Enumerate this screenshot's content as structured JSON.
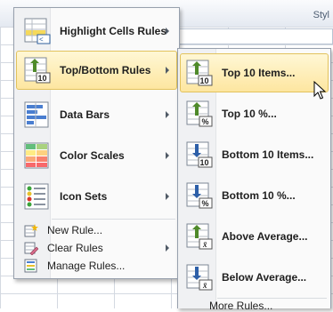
{
  "ribbon": {
    "styles_label": "Styl"
  },
  "main_menu": {
    "items": [
      {
        "label": "Highlight Cells Rules",
        "icon": "highlight-cells-icon",
        "has_submenu": true
      },
      {
        "label": "Top/Bottom Rules",
        "icon": "top-bottom-icon",
        "has_submenu": true,
        "highlighted": true
      },
      {
        "label": "Data Bars",
        "icon": "data-bars-icon",
        "has_submenu": true
      },
      {
        "label": "Color Scales",
        "icon": "color-scales-icon",
        "has_submenu": true
      },
      {
        "label": "Icon Sets",
        "icon": "icon-sets-icon",
        "has_submenu": true
      }
    ],
    "actions": [
      {
        "label": "New Rule...",
        "icon": "new-rule-icon",
        "has_submenu": false
      },
      {
        "label": "Clear Rules",
        "icon": "clear-rules-icon",
        "has_submenu": true
      },
      {
        "label": "Manage Rules...",
        "icon": "manage-rules-icon",
        "has_submenu": false
      }
    ]
  },
  "submenu": {
    "items": [
      {
        "label": "Top 10 Items...",
        "icon": "top-10-items-icon",
        "badge": "10",
        "highlighted": true
      },
      {
        "label": "Top 10 %...",
        "icon": "top-10-percent-icon",
        "badge": "%"
      },
      {
        "label": "Bottom 10 Items...",
        "icon": "bottom-10-items-icon",
        "badge": "10"
      },
      {
        "label": "Bottom 10 %...",
        "icon": "bottom-10-percent-icon",
        "badge": "%"
      },
      {
        "label": "Above Average...",
        "icon": "above-average-icon",
        "badge": "x̄"
      },
      {
        "label": "Below Average...",
        "icon": "below-average-icon",
        "badge": "x̄"
      }
    ],
    "more_rules": "More Rules..."
  },
  "colors": {
    "hover_top": "#fff7d5",
    "hover_bottom": "#fde6a0",
    "hover_border": "#e2c25c",
    "menu_border": "#97a0ad",
    "arrow_up": "#4f8a2a",
    "arrow_down": "#2d5fa8"
  }
}
